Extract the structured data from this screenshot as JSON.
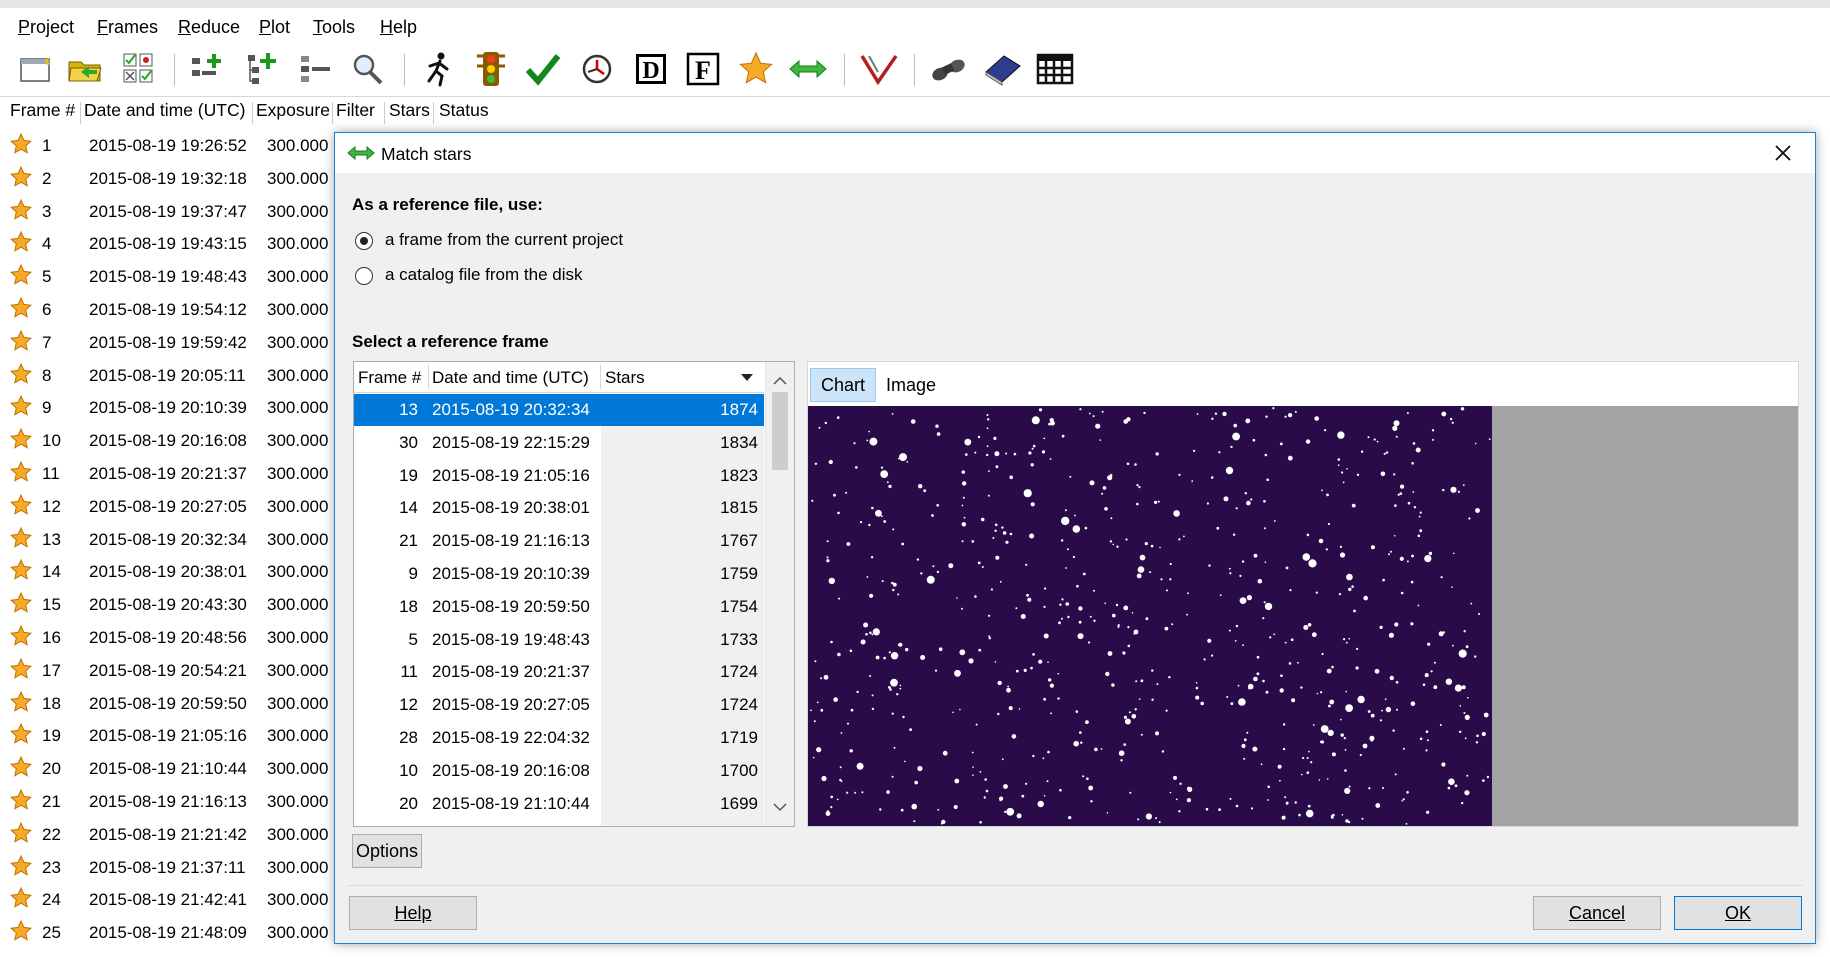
{
  "menu": [
    "Project",
    "Frames",
    "Reduce",
    "Plot",
    "Tools",
    "Help"
  ],
  "toolbar_icons": [
    "new-project-icon",
    "open-project-icon",
    "checklist-icon",
    "add-frames-icon",
    "add-individual-frames-icon",
    "remove-frames-icon",
    "search-icon",
    "run-icon",
    "traffic-light-icon",
    "checkmark-icon",
    "clock-icon",
    "dark-frame-icon",
    "flat-frame-icon",
    "star-icon",
    "match-stars-icon",
    "merge-icon",
    "binoculars-icon",
    "book-icon",
    "table-icon"
  ],
  "main_table": {
    "headers": [
      "Frame #",
      "Date and time (UTC)",
      "Exposure",
      "Filter",
      "Stars",
      "Status"
    ],
    "rows": [
      [
        "1",
        "2015-08-19 19:26:52",
        "300.000"
      ],
      [
        "2",
        "2015-08-19 19:32:18",
        "300.000"
      ],
      [
        "3",
        "2015-08-19 19:37:47",
        "300.000"
      ],
      [
        "4",
        "2015-08-19 19:43:15",
        "300.000"
      ],
      [
        "5",
        "2015-08-19 19:48:43",
        "300.000"
      ],
      [
        "6",
        "2015-08-19 19:54:12",
        "300.000"
      ],
      [
        "7",
        "2015-08-19 19:59:42",
        "300.000"
      ],
      [
        "8",
        "2015-08-19 20:05:11",
        "300.000"
      ],
      [
        "9",
        "2015-08-19 20:10:39",
        "300.000"
      ],
      [
        "10",
        "2015-08-19 20:16:08",
        "300.000"
      ],
      [
        "11",
        "2015-08-19 20:21:37",
        "300.000"
      ],
      [
        "12",
        "2015-08-19 20:27:05",
        "300.000"
      ],
      [
        "13",
        "2015-08-19 20:32:34",
        "300.000"
      ],
      [
        "14",
        "2015-08-19 20:38:01",
        "300.000"
      ],
      [
        "15",
        "2015-08-19 20:43:30",
        "300.000"
      ],
      [
        "16",
        "2015-08-19 20:48:56",
        "300.000"
      ],
      [
        "17",
        "2015-08-19 20:54:21",
        "300.000"
      ],
      [
        "18",
        "2015-08-19 20:59:50",
        "300.000"
      ],
      [
        "19",
        "2015-08-19 21:05:16",
        "300.000"
      ],
      [
        "20",
        "2015-08-19 21:10:44",
        "300.000"
      ],
      [
        "21",
        "2015-08-19 21:16:13",
        "300.000"
      ],
      [
        "22",
        "2015-08-19 21:21:42",
        "300.000"
      ],
      [
        "23",
        "2015-08-19 21:37:11",
        "300.000"
      ],
      [
        "24",
        "2015-08-19 21:42:41",
        "300.000"
      ],
      [
        "25",
        "2015-08-19 21:48:09",
        "300.000"
      ]
    ]
  },
  "dialog": {
    "title": "Match stars",
    "reference_heading": "As a reference file, use:",
    "option_frame": "a frame from the current project",
    "option_catalog": "a catalog file from the disk",
    "select_heading": "Select a reference frame",
    "list_headers": [
      "Frame #",
      "Date and time (UTC)",
      "Stars"
    ],
    "list_rows": [
      [
        "13",
        "2015-08-19 20:32:34",
        "1874"
      ],
      [
        "30",
        "2015-08-19 22:15:29",
        "1834"
      ],
      [
        "19",
        "2015-08-19 21:05:16",
        "1823"
      ],
      [
        "14",
        "2015-08-19 20:38:01",
        "1815"
      ],
      [
        "21",
        "2015-08-19 21:16:13",
        "1767"
      ],
      [
        "9",
        "2015-08-19 20:10:39",
        "1759"
      ],
      [
        "18",
        "2015-08-19 20:59:50",
        "1754"
      ],
      [
        "5",
        "2015-08-19 19:48:43",
        "1733"
      ],
      [
        "11",
        "2015-08-19 20:21:37",
        "1724"
      ],
      [
        "12",
        "2015-08-19 20:27:05",
        "1724"
      ],
      [
        "28",
        "2015-08-19 22:04:32",
        "1719"
      ],
      [
        "10",
        "2015-08-19 20:16:08",
        "1700"
      ],
      [
        "20",
        "2015-08-19 21:10:44",
        "1699"
      ]
    ],
    "selected_row": 0,
    "tabs": [
      "Chart",
      "Image"
    ],
    "active_tab": "Chart",
    "options_label": "Options",
    "help_label": "Help",
    "cancel_label": "Cancel",
    "ok_label": "OK",
    "sky_color": "#2a0b4a",
    "selection_color": "#0078d7"
  }
}
